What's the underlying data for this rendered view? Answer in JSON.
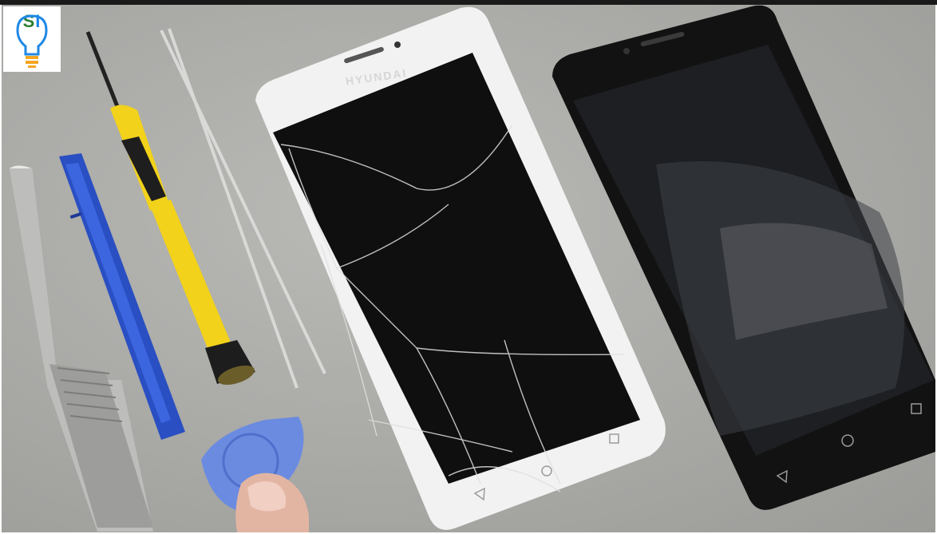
{
  "logo": {
    "letter_s": "S",
    "letter_i": "I"
  },
  "phone_left": {
    "brand_text": "HYUNDAI"
  },
  "colors": {
    "surface": "#aaaaa7",
    "screen": "#0f0f10",
    "phone_white_frame": "#f2f2f2",
    "screwdriver_yellow": "#f2d21a",
    "spudger_blue": "#2a4fc2",
    "pick_blue": "#6b8be0"
  },
  "icons": [
    "lightbulb-icon",
    "back-nav-icon",
    "home-nav-icon",
    "recents-nav-icon"
  ]
}
